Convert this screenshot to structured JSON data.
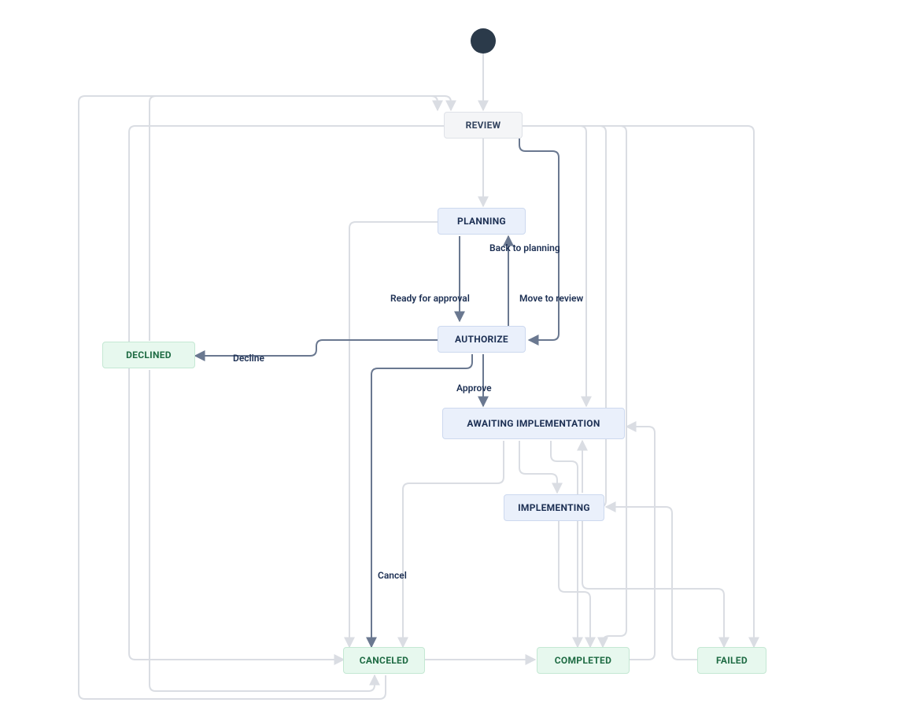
{
  "diagram": {
    "type": "workflow-state-diagram",
    "start_node": true,
    "nodes": {
      "review": {
        "label": "REVIEW",
        "kind": "grey"
      },
      "planning": {
        "label": "PLANNING",
        "kind": "blue"
      },
      "authorize": {
        "label": "AUTHORIZE",
        "kind": "blue"
      },
      "declined": {
        "label": "DECLINED",
        "kind": "green"
      },
      "awaiting": {
        "label": "AWAITING IMPLEMENTATION",
        "kind": "blue"
      },
      "implementing": {
        "label": "IMPLEMENTING",
        "kind": "blue"
      },
      "canceled": {
        "label": "CANCELED",
        "kind": "green"
      },
      "completed": {
        "label": "COMPLETED",
        "kind": "green"
      },
      "failed": {
        "label": "FAILED",
        "kind": "green"
      }
    },
    "edge_labels": {
      "back_to_planning": "Back to planning",
      "ready_for_approval": "Ready for approval",
      "move_to_review": "Move to review",
      "decline": "Decline",
      "approve": "Approve",
      "cancel": "Cancel"
    },
    "edges": [
      {
        "from": "start",
        "to": "review"
      },
      {
        "from": "review",
        "to": "planning"
      },
      {
        "from": "planning",
        "to": "authorize",
        "label": "ready_for_approval",
        "emphasis": true
      },
      {
        "from": "authorize",
        "to": "planning",
        "label": "back_to_planning",
        "emphasis": true
      },
      {
        "from": "review",
        "to": "authorize",
        "label": "move_to_review",
        "emphasis": true
      },
      {
        "from": "authorize",
        "to": "declined",
        "label": "decline",
        "emphasis": true
      },
      {
        "from": "authorize",
        "to": "awaiting",
        "label": "approve",
        "emphasis": true
      },
      {
        "from": "authorize",
        "to": "canceled",
        "label": "cancel",
        "emphasis": true
      },
      {
        "from": "review",
        "to": "awaiting"
      },
      {
        "from": "review",
        "to": "implementing"
      },
      {
        "from": "review",
        "to": "canceled"
      },
      {
        "from": "review",
        "to": "completed"
      },
      {
        "from": "review",
        "to": "failed"
      },
      {
        "from": "planning",
        "to": "canceled"
      },
      {
        "from": "awaiting",
        "to": "implementing"
      },
      {
        "from": "awaiting",
        "to": "canceled"
      },
      {
        "from": "awaiting",
        "to": "completed"
      },
      {
        "from": "implementing",
        "to": "awaiting"
      },
      {
        "from": "implementing",
        "to": "completed"
      },
      {
        "from": "implementing",
        "to": "failed"
      },
      {
        "from": "completed",
        "to": "awaiting"
      },
      {
        "from": "failed",
        "to": "implementing"
      },
      {
        "from": "declined",
        "to": "review"
      },
      {
        "from": "declined",
        "to": "canceled"
      },
      {
        "from": "canceled",
        "to": "review"
      }
    ]
  }
}
